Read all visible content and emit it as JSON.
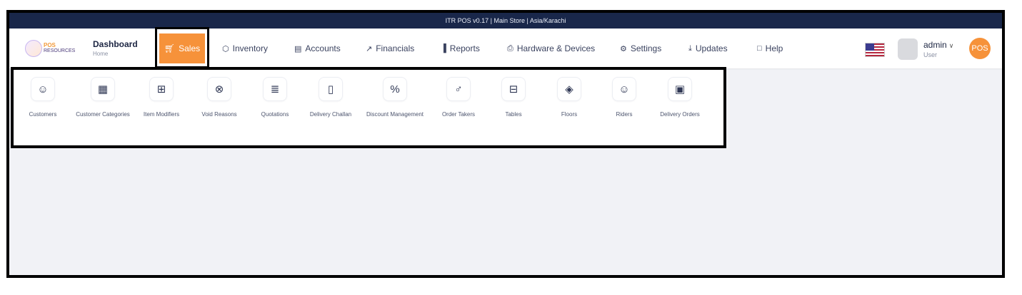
{
  "topbar": {
    "text": "ITR POS v0.17  |  Main Store  |  Asia/Karachi"
  },
  "logo": {
    "brand": "POS",
    "name": "RESOURCES"
  },
  "dashboard": {
    "title": "Dashboard",
    "subtitle": "Home"
  },
  "nav": {
    "sales": "Sales",
    "inventory": "Inventory",
    "accounts": "Accounts",
    "financials": "Financials",
    "reports": "Reports",
    "hardware": "Hardware & Devices",
    "settings": "Settings",
    "updates": "Updates",
    "help": "Help"
  },
  "icons": {
    "sales": "cart-icon",
    "inventory": "box-icon",
    "accounts": "wallet-icon",
    "financials": "trend-icon",
    "reports": "bar-chart-icon",
    "hardware": "printer-icon",
    "settings": "gear-icon",
    "updates": "download-icon",
    "help": "chat-icon"
  },
  "user": {
    "name": "admin",
    "role": "User",
    "badge": "POS"
  },
  "submenu": [
    {
      "label": "Customers",
      "icon": "users-icon"
    },
    {
      "label": "Customer Categories",
      "icon": "map-icon"
    },
    {
      "label": "Item Modifiers",
      "icon": "plus-square-icon"
    },
    {
      "label": "Void Reasons",
      "icon": "x-circle-icon"
    },
    {
      "label": "Quotations",
      "icon": "document-icon"
    },
    {
      "label": "Delivery Challan",
      "icon": "clipboard-icon"
    },
    {
      "label": "Discount Management",
      "icon": "percent-icon"
    },
    {
      "label": "Order Takers",
      "icon": "user-icon"
    },
    {
      "label": "Tables",
      "icon": "table-icon"
    },
    {
      "label": "Floors",
      "icon": "layers-icon"
    },
    {
      "label": "Riders",
      "icon": "users-icon"
    },
    {
      "label": "Delivery Orders",
      "icon": "truck-icon"
    }
  ],
  "colors": {
    "accent": "#f6923a",
    "topbar": "#19274a",
    "background": "#f1f2f6"
  }
}
